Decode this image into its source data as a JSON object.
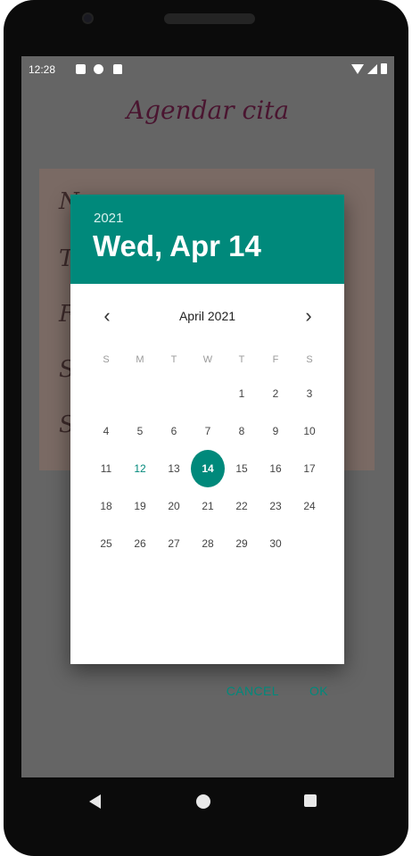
{
  "statusbar": {
    "time": "12:28",
    "icons": [
      "notification-icon",
      "record-icon",
      "sd-card-icon"
    ],
    "right_icons": [
      "wifi-icon",
      "signal-icon",
      "battery-icon"
    ]
  },
  "app": {
    "title": "Agendar cita",
    "form_letters": [
      "N",
      "T",
      "F",
      "S",
      "S"
    ]
  },
  "dialog": {
    "header_year": "2021",
    "header_date": "Wed, Apr 14",
    "month_label": "April 2021",
    "prev_icon": "chevron-left-icon",
    "next_icon": "chevron-right-icon",
    "weekdays": [
      "S",
      "M",
      "T",
      "W",
      "T",
      "F",
      "S"
    ],
    "weeks": [
      [
        "",
        "",
        "",
        "",
        "1",
        "2",
        "3"
      ],
      [
        "4",
        "5",
        "6",
        "7",
        "8",
        "9",
        "10"
      ],
      [
        "11",
        "12",
        "13",
        "14",
        "15",
        "16",
        "17"
      ],
      [
        "18",
        "19",
        "20",
        "21",
        "22",
        "23",
        "24"
      ],
      [
        "25",
        "26",
        "27",
        "28",
        "29",
        "30",
        ""
      ]
    ],
    "today": "12",
    "selected": "14",
    "cancel_label": "CANCEL",
    "ok_label": "OK",
    "accent_color": "#00897b"
  },
  "navbar": {
    "icons": [
      "back-icon",
      "home-icon",
      "recents-icon"
    ]
  }
}
